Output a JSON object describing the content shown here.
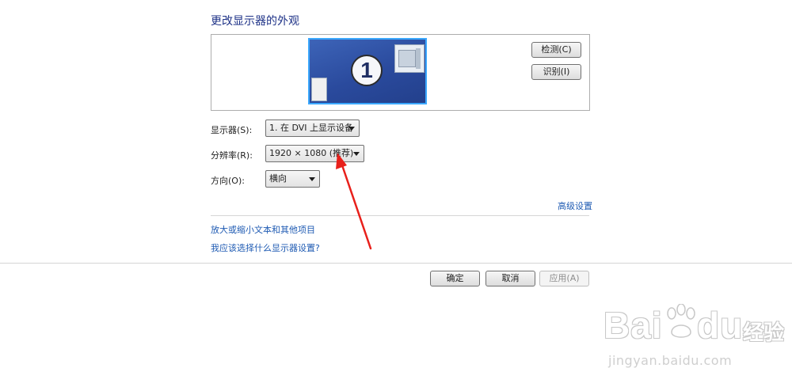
{
  "page": {
    "title": "更改显示器的外观"
  },
  "preview": {
    "monitor_number": "1",
    "detect_button": "检测(C)",
    "identify_button": "识别(I)"
  },
  "settings": {
    "display_label": "显示器(S):",
    "display_value": "1. 在 DVI 上显示设备",
    "resolution_label": "分辨率(R):",
    "resolution_value": "1920 × 1080 (推荐)",
    "orientation_label": "方向(O):",
    "orientation_value": "横向"
  },
  "links": {
    "advanced": "高级设置",
    "text_size": "放大或缩小文本和其他项目",
    "help": "我应该选择什么显示器设置?"
  },
  "footer": {
    "ok": "确定",
    "cancel": "取消",
    "apply": "应用(A)"
  },
  "watermark": {
    "brand": "Bai",
    "brand_tail": "du",
    "brand_cn": "经验",
    "url": "jingyan.baidu.com"
  },
  "colors": {
    "title": "#1e3287",
    "link": "#1f5bb3",
    "monitor_border": "#3ba8ff",
    "annotation_arrow": "#e8201b"
  }
}
